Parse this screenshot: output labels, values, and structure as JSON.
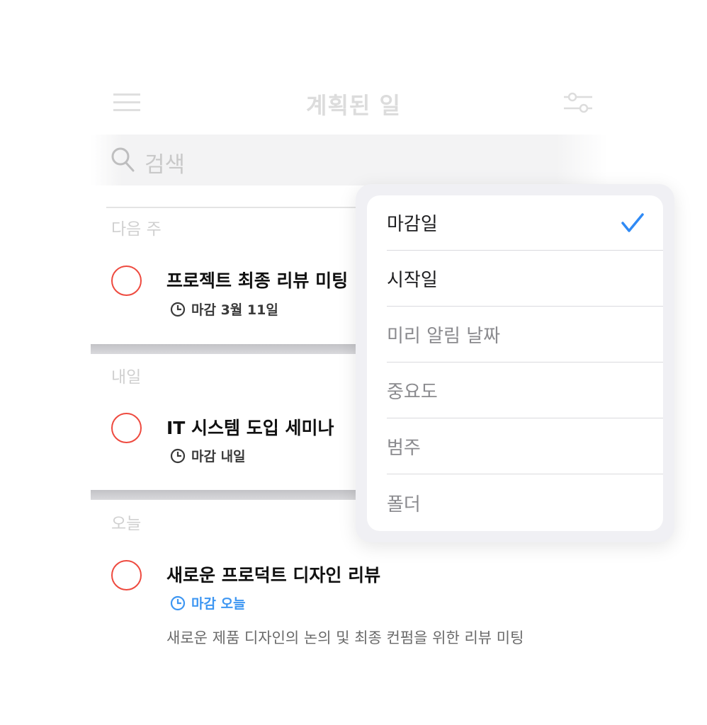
{
  "header": {
    "title": "계획된 일"
  },
  "search": {
    "placeholder": "검색"
  },
  "sections": [
    {
      "label": "다음 주",
      "task": {
        "title": "프로젝트 최종 리뷰 미팅",
        "due": "마감 3월 11일"
      }
    },
    {
      "label": "내일",
      "task": {
        "title": "IT 시스템 도입 세미나",
        "due": "마감 내일"
      }
    },
    {
      "label": "오늘",
      "task": {
        "title": "새로운 프로덕트 디자인 리뷰",
        "due": "마감 오늘",
        "note": "새로운 제품 디자인의 논의 및 최종 컨펌을 위한 리뷰 미팅"
      }
    }
  ],
  "sort_menu": {
    "options": [
      {
        "label": "마감일",
        "selected": true
      },
      {
        "label": "시작일"
      },
      {
        "label": "미리 알림 날짜"
      },
      {
        "label": "중요도"
      },
      {
        "label": "범주"
      },
      {
        "label": "폴더"
      }
    ]
  },
  "colors": {
    "accent_blue": "#3d96f2",
    "task_circle": "#ee4a3f",
    "check": "#2f8af5"
  },
  "icons": [
    "menu-icon",
    "filter-icon",
    "search-icon",
    "clock-icon",
    "checkmark-icon"
  ]
}
